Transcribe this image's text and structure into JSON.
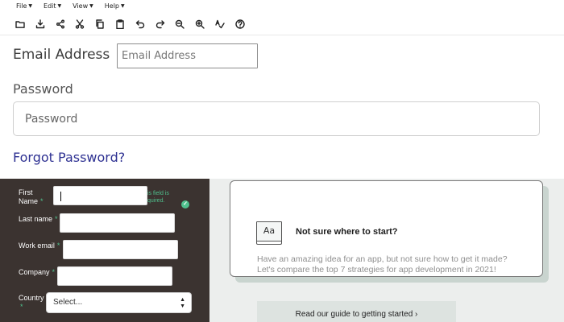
{
  "menubar": {
    "menus": [
      {
        "label": "File"
      },
      {
        "label": "Edit"
      },
      {
        "label": "View"
      },
      {
        "label": "Help"
      }
    ],
    "caret": "▼",
    "tools": [
      "open-folder-icon",
      "download-icon",
      "share-icon",
      "cut-icon",
      "copy-icon",
      "paste-icon",
      "undo-icon",
      "redo-icon",
      "zoom-out-icon",
      "zoom-in-icon",
      "spellcheck-icon",
      "help-icon"
    ]
  },
  "login": {
    "email_label": "Email Address",
    "email_placeholder": "Email Address",
    "password_label": "Password",
    "password_placeholder": "Password",
    "forgot_label": "Forgot Password?"
  },
  "signup": {
    "first_name_label_line1": "First",
    "first_name_label_line2": "Name",
    "last_name_label": "Last name",
    "work_email_label": "Work email",
    "company_label": "Company",
    "country_label": "Country",
    "required_mark": "*",
    "error_line1": "is field is",
    "error_line2": "quired.",
    "country_value": "Select...",
    "accent_color": "#4fc08d",
    "panel_color": "#3b3330"
  },
  "card": {
    "icon_text": "Aa",
    "title": "Not sure where to start?",
    "body": "Have an amazing idea for an app, but not sure how to get it made? Let's compare the top 7 strategies for app development in 2021!",
    "button_label": "Read our guide to getting started ›"
  }
}
